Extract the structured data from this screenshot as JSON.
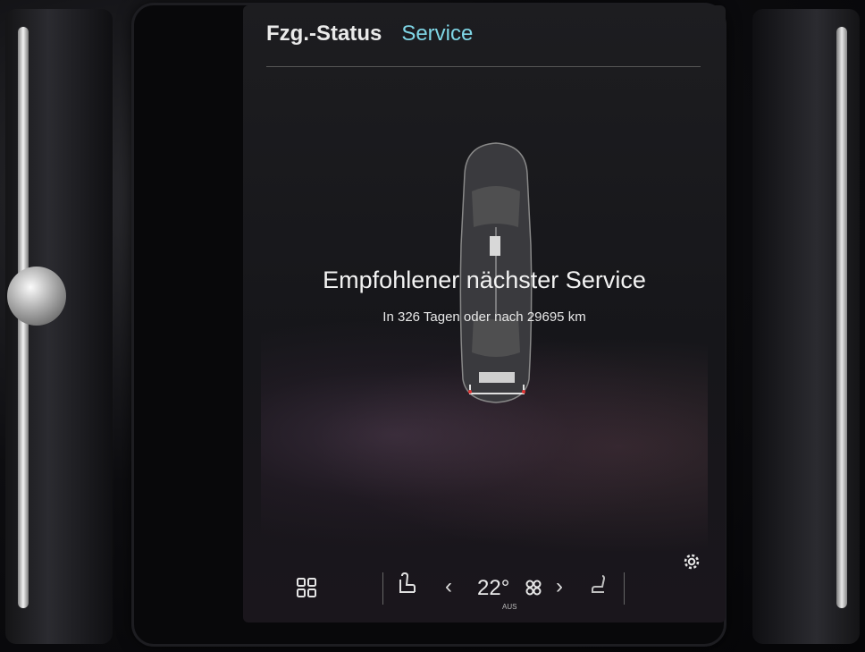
{
  "tabs": [
    {
      "label": "Fzg.-Status",
      "active": false
    },
    {
      "label": "Service",
      "active": true
    }
  ],
  "service": {
    "headline": "Empfohlener nächster Service",
    "detail": "In 326 Tagen oder nach 29695 km"
  },
  "climate": {
    "temperature": "22°",
    "fan_status": "AUS"
  },
  "icons": {
    "apps": "apps-grid-icon",
    "seat_heat_left": "seat-heating-icon",
    "temp_down": "chevron-left-icon",
    "fan": "fan-icon",
    "temp_up": "chevron-right-icon",
    "seat_right": "seat-icon",
    "settings": "gear-icon"
  },
  "colors": {
    "active_tab": "#7fd6e6",
    "text": "#f2f2f2",
    "screen_bg": "#1a1a1d"
  }
}
